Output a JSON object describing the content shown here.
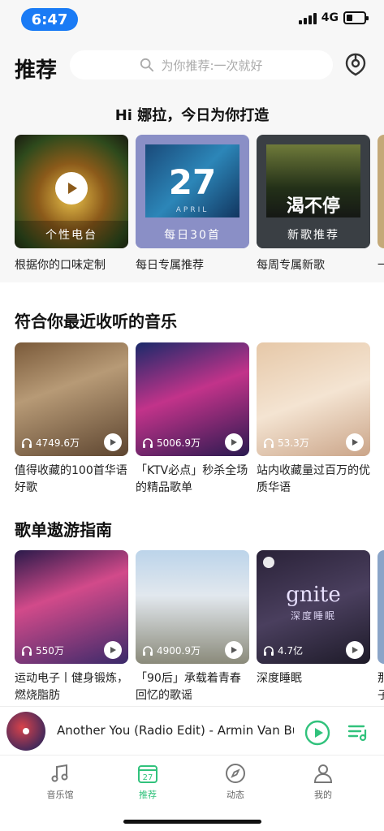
{
  "status_bar": {
    "time": "6:47",
    "network": "4G"
  },
  "header": {
    "title": "推荐",
    "search_placeholder": "为你推荐:一次就好"
  },
  "greeting": "Hi 娜拉，今日为你打造",
  "recommendations": [
    {
      "cover_label": "个性电台",
      "subtitle": "根据你的口味定制"
    },
    {
      "cover_label": "每日30首",
      "subtitle": "每日专属推荐",
      "cover_number": "27",
      "cover_month": "APRIL"
    },
    {
      "cover_label": "新歌推荐",
      "subtitle": "每周专属新歌",
      "cover_title": "渴不停"
    },
    {
      "subtitle": "一"
    }
  ],
  "section_recent": {
    "title": "符合你最近收听的音乐",
    "items": [
      {
        "plays": "4749.6万",
        "text": "值得收藏的100首华语好歌"
      },
      {
        "plays": "5006.9万",
        "text": "「KTV必点」秒杀全场的精品歌单"
      },
      {
        "plays": "53.3万",
        "text": "站内收藏量过百万的优质华语"
      }
    ]
  },
  "section_guide": {
    "title": "歌单遨游指南",
    "items": [
      {
        "plays": "550万",
        "text": "运动电子丨健身锻炼，燃烧脂肪"
      },
      {
        "plays": "4900.9万",
        "text": "「90后」承载着青春回忆的歌谣"
      },
      {
        "plays": "4.7亿",
        "text": "深度睡眠",
        "cover_title": "gnite",
        "cover_sub": "深度睡眠"
      }
    ],
    "edge_text": "那\n子"
  },
  "player": {
    "now_playing": "Another You (Radio Edit) - Armin Van Buuren"
  },
  "tabs": [
    {
      "label": "音乐馆"
    },
    {
      "label": "推荐",
      "icon_text": "27"
    },
    {
      "label": "动态"
    },
    {
      "label": "我的"
    }
  ],
  "colors": {
    "accent": "#31c27c",
    "time_pill": "#1a7bf5"
  }
}
